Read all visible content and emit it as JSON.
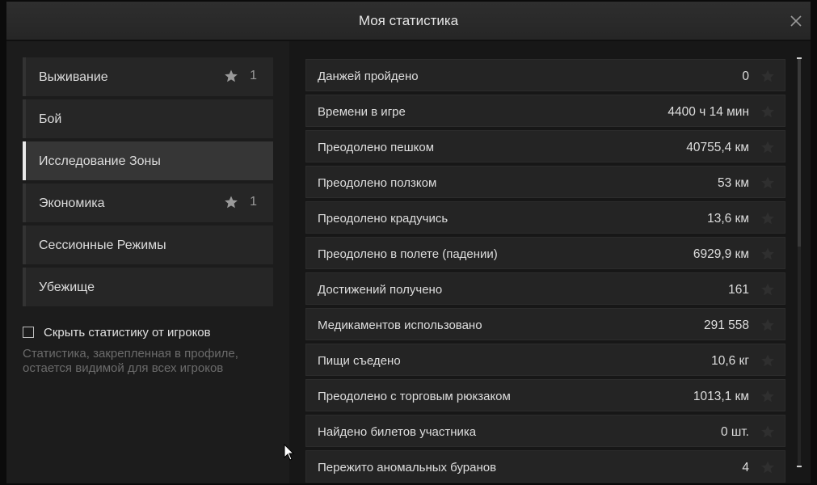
{
  "dialog": {
    "title": "Моя статистика",
    "close_icon": "close-icon"
  },
  "categories": [
    {
      "label": "Выживание",
      "star_icon": "star-icon",
      "count": "1",
      "active": false
    },
    {
      "label": "Бой",
      "active": false
    },
    {
      "label": "Исследование Зоны",
      "active": true
    },
    {
      "label": "Экономика",
      "star_icon": "star-icon",
      "count": "1",
      "active": false
    },
    {
      "label": "Сессионные Режимы",
      "active": false
    },
    {
      "label": "Убежище",
      "active": false
    }
  ],
  "privacy": {
    "checkbox_label": "Скрыть статистику от игроков",
    "checked": false,
    "hint_line1": "Статистика, закрепленная в профиле,",
    "hint_line2": "остается видимой для всех игроков"
  },
  "stats": [
    {
      "name": "Данжей пройдено",
      "value": "0"
    },
    {
      "name": "Времени в игре",
      "value": "4400 ч 14 мин"
    },
    {
      "name": "Преодолено пешком",
      "value": "40755,4 км"
    },
    {
      "name": "Преодолено ползком",
      "value": "53 км"
    },
    {
      "name": "Преодолено крадучись",
      "value": "13,6 км"
    },
    {
      "name": "Преодолено в полете (падении)",
      "value": "6929,9 км"
    },
    {
      "name": "Достижений получено",
      "value": "161"
    },
    {
      "name": "Медикаментов использовано",
      "value": "291 558"
    },
    {
      "name": "Пищи съедено",
      "value": "10,6 кг"
    },
    {
      "name": "Преодолено с торговым рюкзаком",
      "value": "1013,1 км"
    },
    {
      "name": "Найдено билетов участника",
      "value": "0 шт."
    },
    {
      "name": "Пережито аномальных буранов",
      "value": "4"
    }
  ],
  "colors": {
    "accent": "#e9e9e9",
    "panel": "#1b1b1b",
    "row": "#242424",
    "muted_text": "#6b6b6b"
  }
}
